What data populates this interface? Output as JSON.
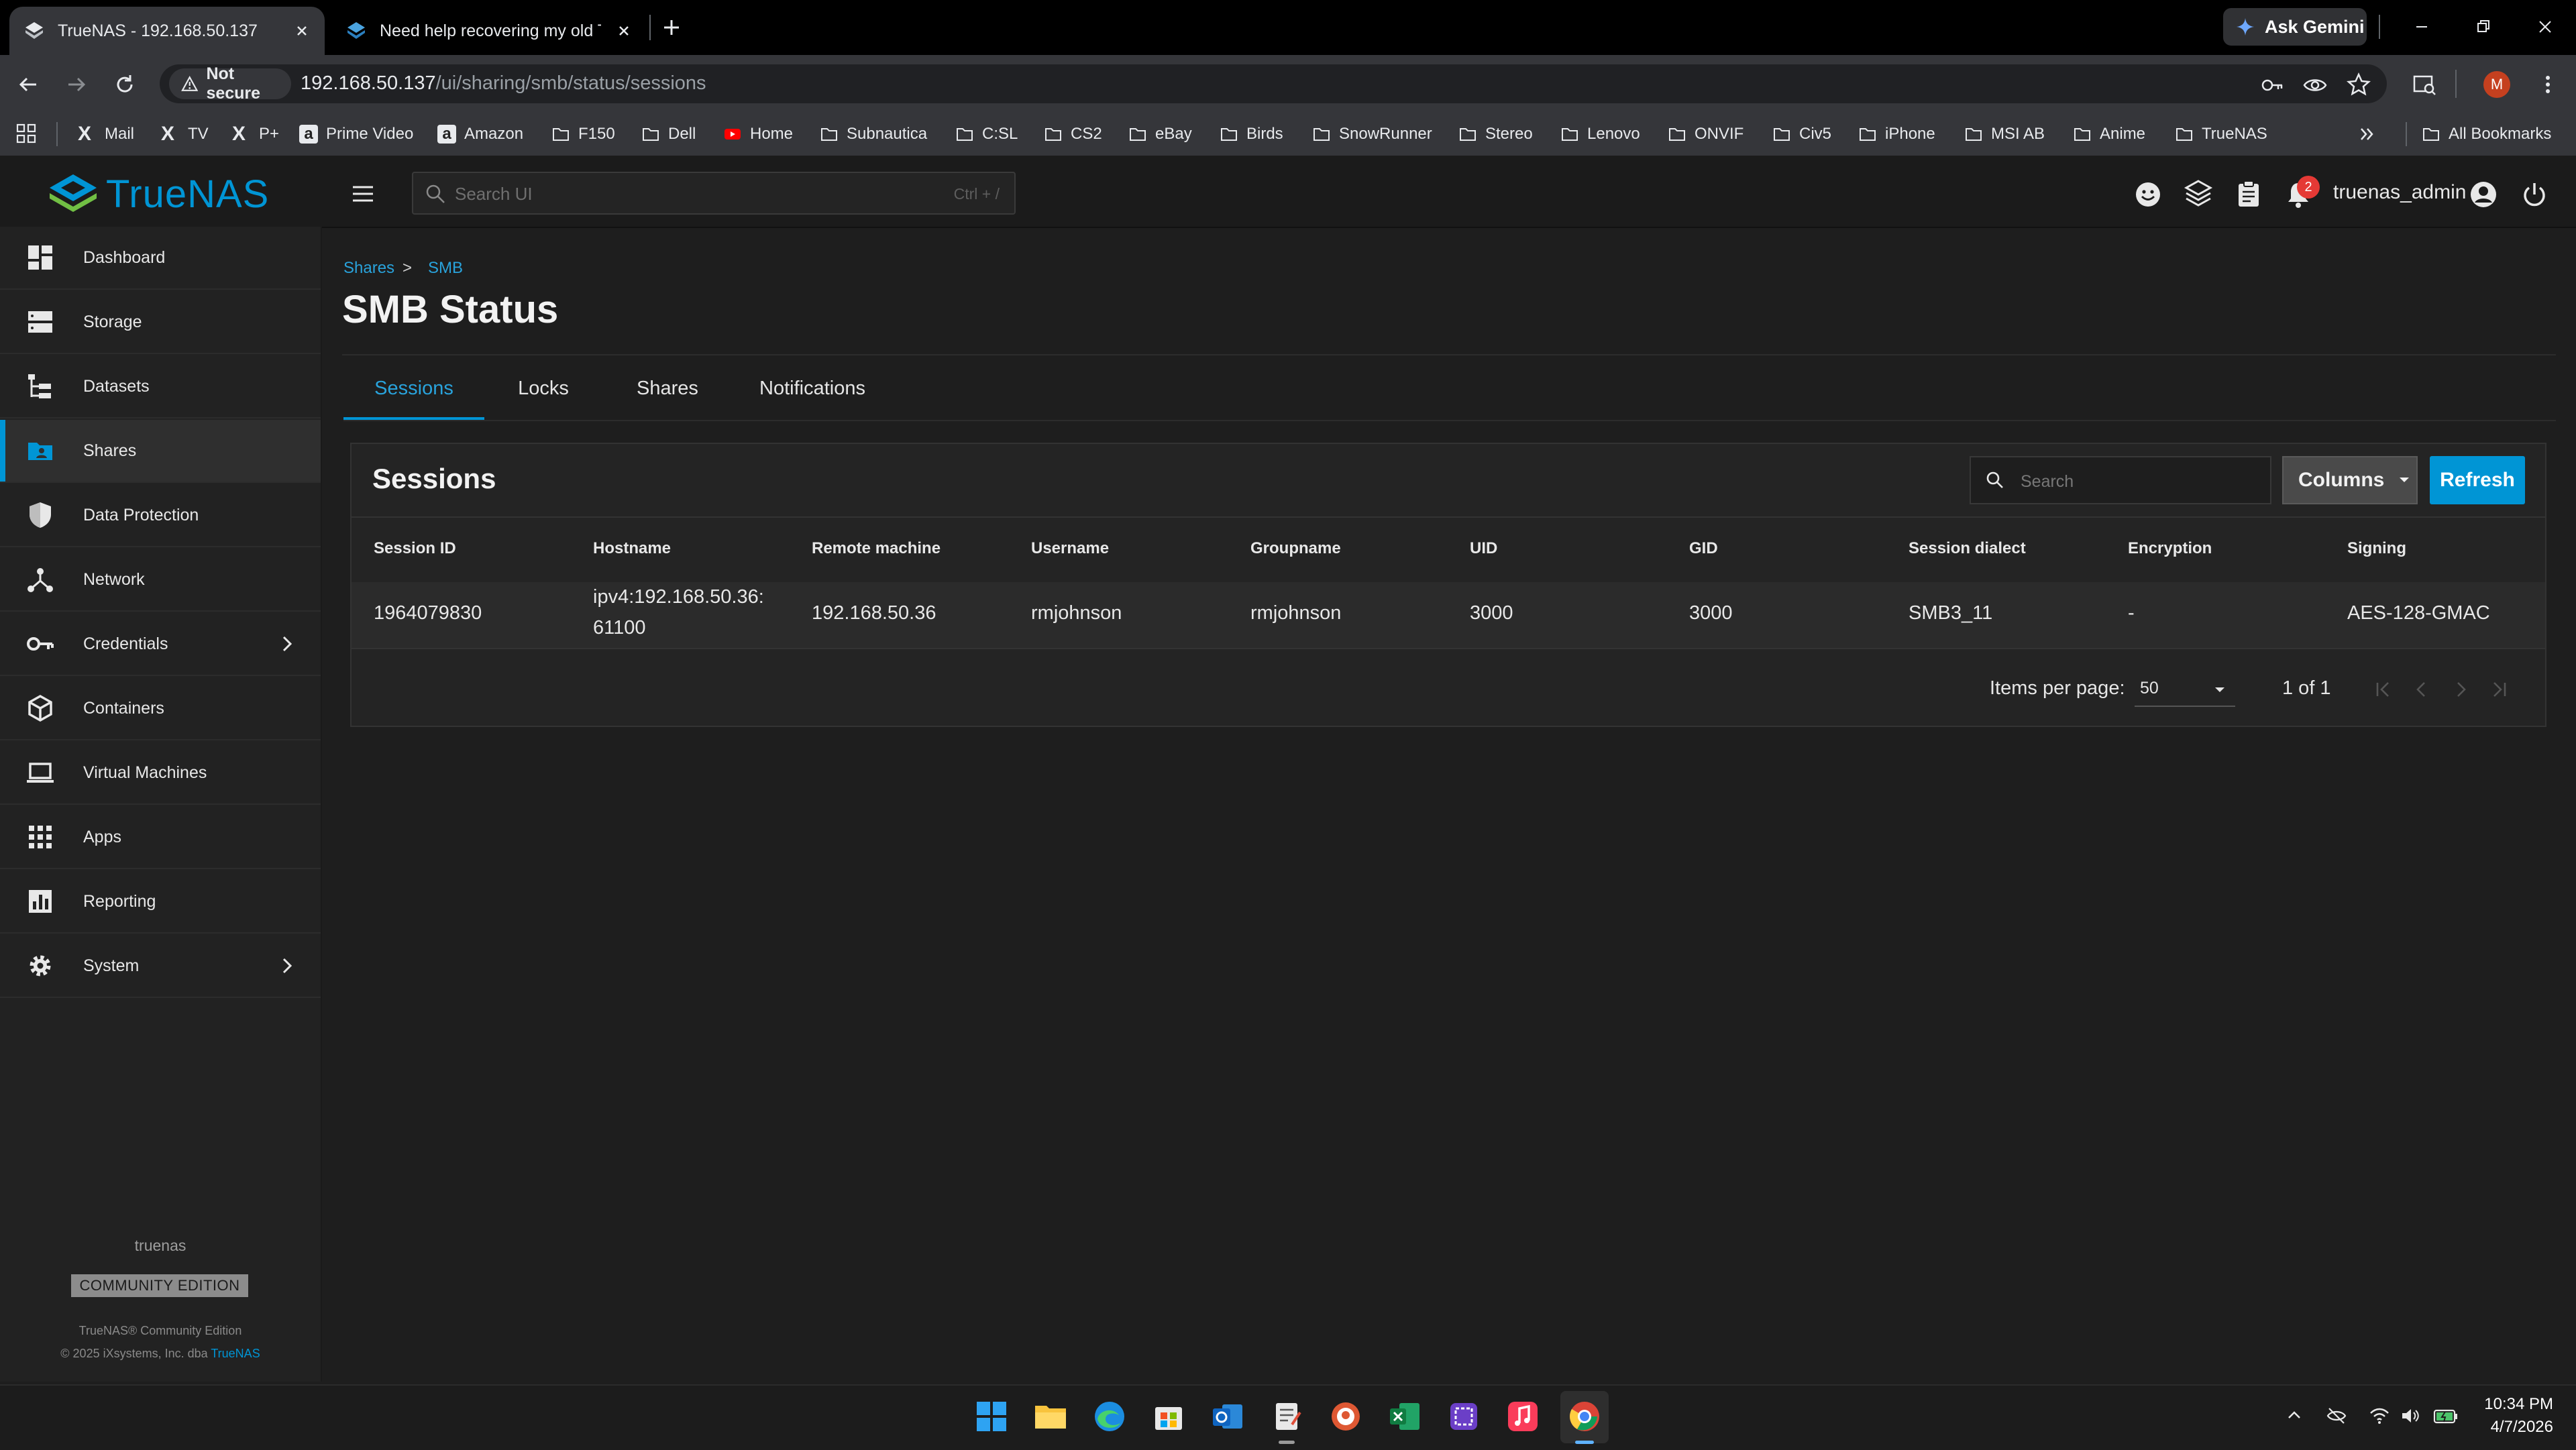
{
  "browser": {
    "tabs": [
      {
        "title": "TrueNAS - 192.168.50.137",
        "active": true
      },
      {
        "title": "Need help recovering my old Tr",
        "active": false
      }
    ],
    "gemini_label": "Ask Gemini",
    "security_label": "Not secure",
    "url_host": "192.168.50.137",
    "url_path": "/ui/sharing/smb/status/sessions",
    "profile_initial": "M",
    "bookmarks": [
      "Mail",
      "TV",
      "P+",
      "Prime Video",
      "Amazon",
      "F150",
      "Dell",
      "Home",
      "Subnautica",
      "C:SL",
      "CS2",
      "eBay",
      "Birds",
      "SnowRunner",
      "Stereo",
      "Lenovo",
      "ONVIF",
      "Civ5",
      "iPhone",
      "MSI AB",
      "Anime",
      "TrueNAS"
    ],
    "all_bookmarks": "All Bookmarks"
  },
  "header": {
    "logo_text": "TrueNAS",
    "search_placeholder": "Search UI",
    "search_shortcut": "Ctrl + /",
    "notification_count": "2",
    "username": "truenas_admin"
  },
  "sidebar": {
    "items": [
      {
        "label": "Dashboard",
        "icon": "dashboard-icon"
      },
      {
        "label": "Storage",
        "icon": "storage-icon"
      },
      {
        "label": "Datasets",
        "icon": "datasets-icon"
      },
      {
        "label": "Shares",
        "icon": "shares-icon",
        "active": true
      },
      {
        "label": "Data Protection",
        "icon": "shield-icon"
      },
      {
        "label": "Network",
        "icon": "network-icon"
      },
      {
        "label": "Credentials",
        "icon": "key-icon",
        "expandable": true
      },
      {
        "label": "Containers",
        "icon": "cube-icon"
      },
      {
        "label": "Virtual Machines",
        "icon": "laptop-icon"
      },
      {
        "label": "Apps",
        "icon": "apps-grid-icon"
      },
      {
        "label": "Reporting",
        "icon": "chart-icon"
      },
      {
        "label": "System",
        "icon": "gear-icon",
        "expandable": true
      }
    ],
    "hostname": "truenas",
    "edition": "COMMUNITY EDITION",
    "copyright_line1": "TrueNAS® Community Edition",
    "copyright_line2": "© 2025 iXsystems, Inc. dba",
    "copyright_link": "TrueNAS"
  },
  "main": {
    "breadcrumb": [
      "Shares",
      "SMB"
    ],
    "breadcrumb_separator": ">",
    "title": "SMB Status",
    "tabs": [
      "Sessions",
      "Locks",
      "Shares",
      "Notifications"
    ],
    "active_tab": "Sessions",
    "card_title": "Sessions",
    "search_placeholder": "Search",
    "columns_button": "Columns",
    "refresh_button": "Refresh",
    "table": {
      "headers": [
        "Session ID",
        "Hostname",
        "Remote machine",
        "Username",
        "Groupname",
        "UID",
        "GID",
        "Session dialect",
        "Encryption",
        "Signing"
      ],
      "rows": [
        {
          "session_id": "1964079830",
          "hostname_line1": "ipv4:192.168.50.36:",
          "hostname_line2": "61100",
          "remote_machine": "192.168.50.36",
          "username": "rmjohnson",
          "groupname": "rmjohnson",
          "uid": "3000",
          "gid": "3000",
          "dialect": "SMB3_11",
          "encryption": "-",
          "signing": "AES-128-GMAC"
        }
      ]
    },
    "paginator": {
      "items_per_page_label": "Items per page:",
      "items_per_page": "50",
      "range": "1 of 1"
    }
  },
  "taskbar": {
    "time": "10:34 PM",
    "date": "4/7/2026"
  },
  "colors": {
    "accent": "#0095d5",
    "background": "#1e1e1e",
    "sidebar": "#222222",
    "card": "#242424"
  }
}
